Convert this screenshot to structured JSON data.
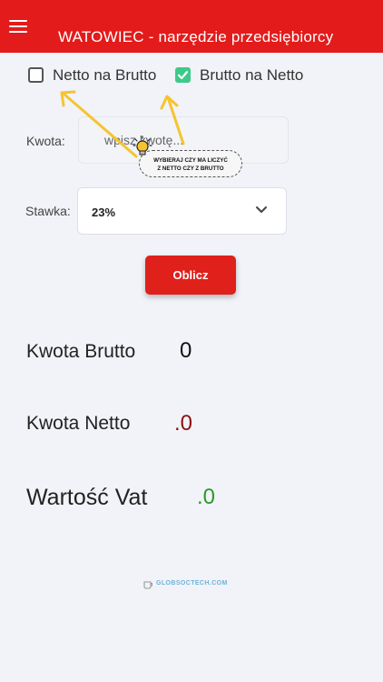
{
  "appbar": {
    "title": "WATOWIEC - narzędzie przedsiębiorcy"
  },
  "mode": {
    "netto_na_brutto_label": "Netto na Brutto",
    "netto_na_brutto_checked": false,
    "brutto_na_netto_label": "Brutto na Netto",
    "brutto_na_netto_checked": true
  },
  "form": {
    "kwota_label": "Kwota:",
    "kwota_placeholder": "wpisz kwotę...",
    "stawka_label": "Stawka:",
    "stawka_value": "23%"
  },
  "hint": {
    "line1": "WYBIERAJ CZY MA LICZYĆ",
    "line2": "Z NETTO CZY Z BRUTTO"
  },
  "actions": {
    "calc_label": "Oblicz"
  },
  "results": {
    "brutto_label": "Kwota Brutto",
    "brutto_value": "0",
    "netto_label": "Kwota Netto",
    "netto_value": ".0",
    "vat_label": "Wartość Vat",
    "vat_value": ".0"
  },
  "footer": {
    "brand": "GLOBSOCTECH.COM"
  },
  "colors": {
    "primary": "#e31b1b",
    "check": "#3ec98a",
    "netto": "#8b1010",
    "vat": "#2a9a2a",
    "arrow": "#f5c430"
  },
  "icons": [
    "menu-icon",
    "check-icon",
    "chevron-down-icon",
    "lightbulb-icon",
    "cup-icon"
  ]
}
